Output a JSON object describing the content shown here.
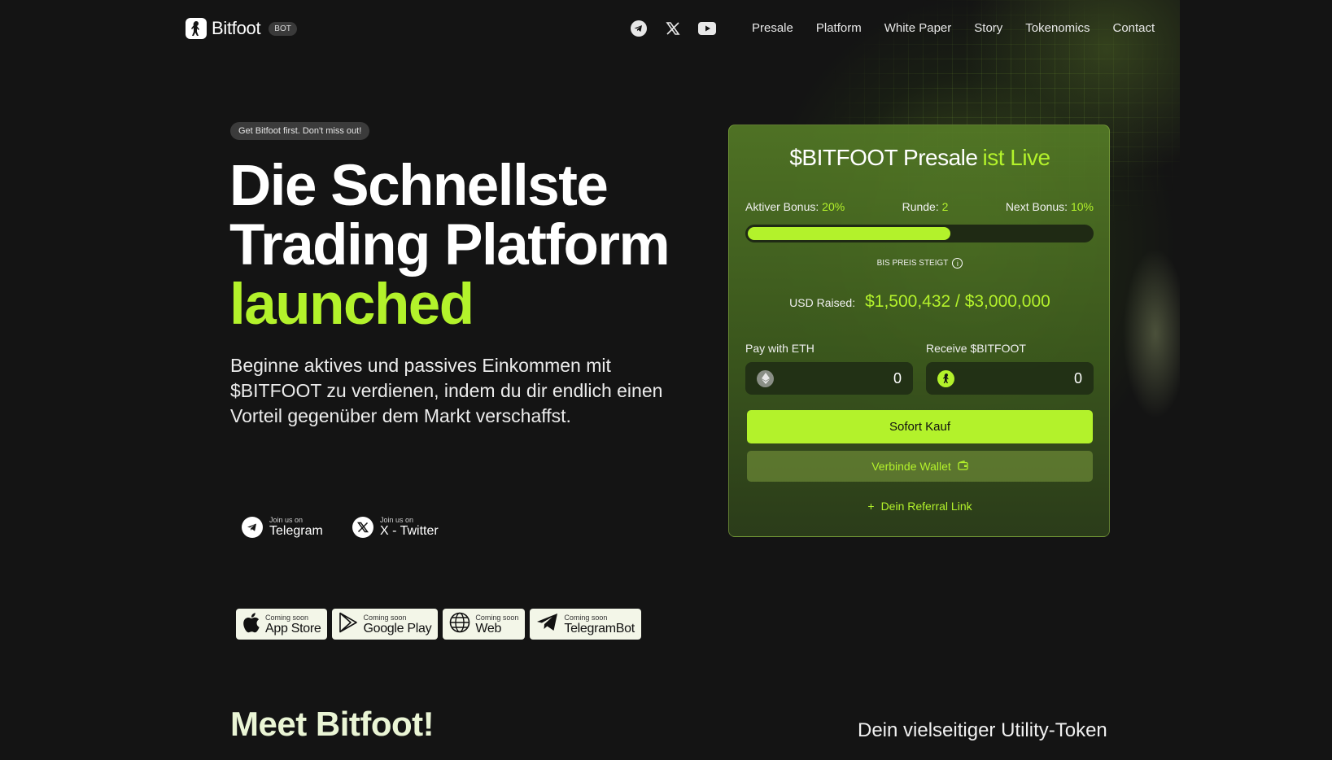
{
  "colors": {
    "accent": "#b3f22b",
    "background": "#141414",
    "card": "#4d722a"
  },
  "header": {
    "logo_text": "Bitfoot",
    "logo_badge": "BOT",
    "social_icons": [
      "telegram-icon",
      "x-icon",
      "youtube-icon"
    ],
    "nav": [
      {
        "label": "Presale"
      },
      {
        "label": "Platform"
      },
      {
        "label": "White Paper"
      },
      {
        "label": "Story"
      },
      {
        "label": "Tokenomics"
      },
      {
        "label": "Contact"
      }
    ]
  },
  "hero": {
    "pill": "Get Bitfoot first. Don't miss out!",
    "headline_line1": "Die Schnellste",
    "headline_line2": "Trading Platform",
    "headline_line3": "launched",
    "subtext": "Beginne aktives und passives Einkommen mit $BITFOOT zu verdienen, indem du dir endlich einen Vorteil gegenüber dem Markt verschaffst."
  },
  "join": [
    {
      "small": "Join us on",
      "big": "Telegram",
      "icon": "telegram-icon"
    },
    {
      "small": "Join us on",
      "big": "X - Twitter",
      "icon": "x-icon"
    }
  ],
  "stores": [
    {
      "small": "Coming soon",
      "big": "App Store",
      "icon": "apple-icon"
    },
    {
      "small": "Coming soon",
      "big": "Google Play",
      "icon": "google-play-icon"
    },
    {
      "small": "Coming soon",
      "big": "Web",
      "icon": "globe-icon"
    },
    {
      "small": "Coming soon",
      "big": "TelegramBot",
      "icon": "telegram-icon"
    }
  ],
  "presale": {
    "title": "$BITFOOT Presale",
    "title_live": "ist Live",
    "active_bonus_label": "Aktiver Bonus:",
    "active_bonus_value": "20%",
    "round_label": "Runde:",
    "round_value": "2",
    "next_bonus_label": "Next Bonus:",
    "next_bonus_value": "10%",
    "progress_fraction": 0.59,
    "until_price_rises": "BIS PREIS STEIGT",
    "raised_label": "USD Raised:",
    "raised_value": "$1,500,432 / $3,000,000",
    "pay_label": "Pay with ETH",
    "pay_value": "0",
    "receive_label": "Receive $BITFOOT",
    "receive_value": "0",
    "buy_button": "Sofort Kauf",
    "wallet_button": "Verbinde Wallet",
    "referral": "Dein Referral Link",
    "referral_plus": "+"
  },
  "sections": {
    "meet": "Meet Bitfoot!",
    "utility": "Dein vielseitiger Utility-Token"
  }
}
